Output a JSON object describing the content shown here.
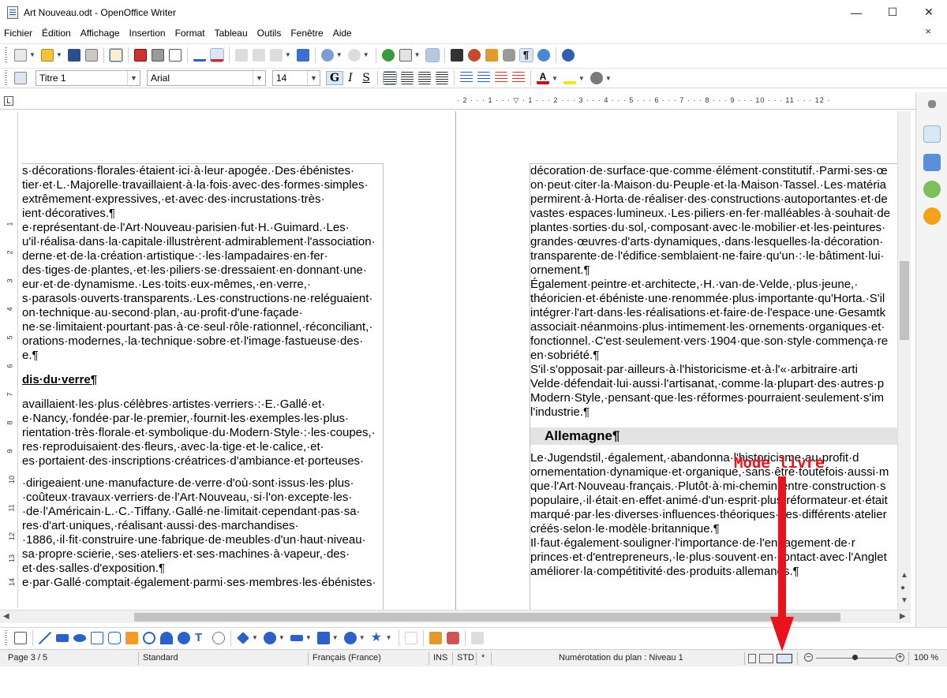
{
  "window": {
    "title": "Art Nouveau.odt - OpenOffice Writer",
    "minimize": "—",
    "maximize": "☐",
    "close": "✕"
  },
  "menu": [
    "Fichier",
    "Édition",
    "Affichage",
    "Insertion",
    "Format",
    "Tableau",
    "Outils",
    "Fenêtre",
    "Aide"
  ],
  "menu_close": "×",
  "formatting": {
    "style": "Titre 1",
    "font": "Arial",
    "size": "14",
    "bold": "G",
    "italic": "I",
    "underline": "S"
  },
  "ruler": {
    "corner": "L",
    "top_marks": "· 2 · · · 1 · · · ▽ · 1 · · · 2 · · · 3 · · · 4 · · · 5 · · · 6 · · · 7 · · · 8 · · · 9 · · · 10 · · · 11 · · · 12 ·",
    "left_marks": [
      "1",
      "2",
      "3",
      "4",
      "5",
      "6",
      "7",
      "8",
      "9",
      "10",
      "11",
      "12",
      "13",
      "14"
    ]
  },
  "left_page": {
    "lines": [
      "s·décorations·florales·étaient·ici·à·leur·apogée.·Des·ébénistes·",
      "tier·et·L.·Majorelle·travaillaient·à·la·fois·avec·des·formes·simples·",
      "extrêmement·expressives,·et·avec·des·incrustations·très·",
      "ient·décoratives.¶",
      "e·représentant·de·l'Art·Nouveau·parisien·fut·H.·Guimard.·Les·",
      "u'il·réalisa·dans·la·capitale·illustrèrent·admirablement·l'association·",
      "derne·et·de·la·création·artistique·:·les·lampadaires·en·fer·",
      "des·tiges·de·plantes,·et·les·piliers·se·dressaient·en·donnant·une·",
      "eur·et·de·dynamisme.·Les·toits·eux-mêmes,·en·verre,·",
      "s·parasols·ouverts·transparents.·Les·constructions·ne·reléguaient·",
      "on·technique·au·second·plan,·au·profit·d'une·façade·",
      "ne·se·limitaient·pourtant·pas·à·ce·seul·rôle·rationnel,·réconciliant,·",
      "orations·modernes,·la·technique·sobre·et·l'image·fastueuse·des·",
      "e.¶"
    ],
    "heading": "dis·du·verre¶",
    "lines2": [
      "availlaient·les·plus·célèbres·artistes·verriers·:·E.·Gallé·et·",
      "e·Nancy,·fondée·par·le·premier,·fournit·les·exemples·les·plus·",
      "rientation·très·florale·et·symbolique·du·Modern·Style·:·les·coupes,·",
      "res·reproduisaient·des·fleurs,·avec·la·tige·et·le·calice,·et·",
      "es·portaient·des·inscriptions·créatrices·d'ambiance·et·porteuses·"
    ],
    "lines3": [
      "·dirigeaient·une·manufacture·de·verre·d'où·sont·issus·les·plus·",
      "·coûteux·travaux·verriers·de·l'Art·Nouveau,·si·l'on·excepte·les·",
      "·de·l'Américain·L.·C.·Tiffany.·Gallé·ne·limitait·cependant·pas·sa·",
      "res·d'art·uniques,·réalisant·aussi·des·marchandises·",
      "·1886,·il·fit·construire·une·fabrique·de·meubles·d'un·haut·niveau·",
      "sa·propre·scierie,·ses·ateliers·et·ses·machines·à·vapeur,·des·",
      "et·des·salles·d'exposition.¶",
      "e·par·Gallé·comptait·également·parmi·ses·membres·les·ébénistes·"
    ]
  },
  "right_page": {
    "lines": [
      "décoration·de·surface·que·comme·élément·constitutif.·Parmi·ses·œ",
      "on·peut·citer·la·Maison·du·Peuple·et·la·Maison·Tassel.·Les·matéria",
      "permirent·à·Horta·de·réaliser·des·constructions·autoportantes·et·de",
      "vastes·espaces·lumineux.·Les·piliers·en·fer·malléables·à·souhait·de",
      "plantes·sorties·du·sol,·composant·avec·le·mobilier·et·les·peintures·",
      "grandes·œuvres·d'arts·dynamiques,·dans·lesquelles·la·décoration·",
      "transparente·de·l'édifice·semblaient·ne·faire·qu'un·:·le·bâtiment·lui·",
      "ornement.¶",
      "        Également·peintre·et·architecte,·H.·van·de·Velde,·plus·jeune,·",
      "théoricien·et·ébéniste·une·renommée·plus·importante·qu'Horta.·S'il",
      "intégrer·l'art·dans·les·réalisations·et·faire·de·l'espace·une·Gesamtk",
      "associait·néanmoins·plus·intimement·les·ornements·organiques·et·",
      "fonctionnel.·C'est·seulement·vers·1904·que·son·style·commença·re",
      "en·sobriété.¶",
      "        S'il·s'opposait·par·ailleurs·à·l'historicisme·et·à·l'«·arbitraire·arti",
      "Velde·défendait·lui·aussi·l'artisanat,·comme·la·plupart·des·autres·p",
      "Modern·Style,·pensant·que·les·réformes·pourraient·seulement·s'im",
      "l'industrie.¶"
    ],
    "heading": "Allemagne¶",
    "lines2": [
      "        Le·Jugendstil,·également,·abandonna·l'historicisme·au·profit·d",
      "ornementation·dynamique·et·organique,·sans·être·toutefois·aussi·m",
      "que·l'Art·Nouveau·français.·Plutôt·à·mi-chemin·entre·construction·s",
      "populaire,·il·était·en·effet·animé·d'un·esprit·plus·réformateur·et·était",
      "marqué·par·les·diverses·influences·théoriques·des·différents·atelier",
      "créés·selon·le·modèle·britannique.¶",
      "        Il·faut·également·souligner·l'importance·de·l'engagement·de·r",
      "princes·et·d'entrepreneurs,·le·plus·souvent·en·contact·avec·l'Anglet",
      "améliorer·la·compétitivité·des·produits·allemands.¶"
    ]
  },
  "annotation": "Mode livre",
  "status": {
    "page": "Page 3 / 5",
    "style": "Standard",
    "language": "Français (France)",
    "ins": "INS",
    "std": "STD",
    "star": "*",
    "outline": "Numérotation du plan : Niveau 1",
    "zoom": "100 %"
  },
  "colors": {
    "accent": "#e8131b",
    "highlight": "#dbe7f5"
  }
}
